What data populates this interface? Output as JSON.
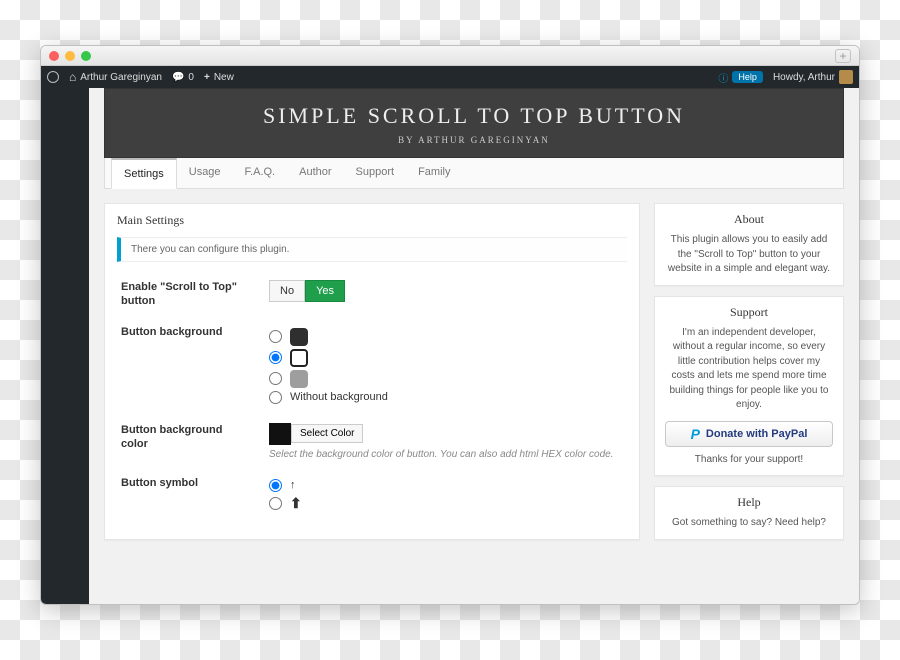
{
  "adminbar": {
    "site_name": "Arthur Gareginyan",
    "comments_count": "0",
    "new_label": "New",
    "help_label": "Help",
    "howdy": "Howdy, Arthur"
  },
  "banner": {
    "title": "SIMPLE SCROLL TO TOP BUTTON",
    "byline": "BY ARTHUR GAREGINYAN"
  },
  "tabs": {
    "settings": "Settings",
    "usage": "Usage",
    "faq": "F.A.Q.",
    "author": "Author",
    "support": "Support",
    "family": "Family"
  },
  "main": {
    "panel_title": "Main Settings",
    "notice": "There you can configure this plugin.",
    "enable_label": "Enable \"Scroll to Top\" button",
    "toggle_no": "No",
    "toggle_yes": "Yes",
    "bg_label": "Button background",
    "bg_opt_without": "Without background",
    "color_label": "Button background color",
    "select_color": "Select Color",
    "color_desc": "Select the background color of button. You can also add html HEX color code.",
    "symbol_label": "Button symbol"
  },
  "side": {
    "about_title": "About",
    "about_text": "This plugin allows you to easily add the \"Scroll to Top\" button to your website in a simple and elegant way.",
    "support_title": "Support",
    "support_text": "I'm an independent developer, without a regular income, so every little contribution helps cover my costs and lets me spend more time building things for people like you to enjoy.",
    "paypal_label": "Donate with PayPal",
    "thanks": "Thanks for your support!",
    "help_title": "Help",
    "help_text": "Got something to say? Need help?"
  }
}
